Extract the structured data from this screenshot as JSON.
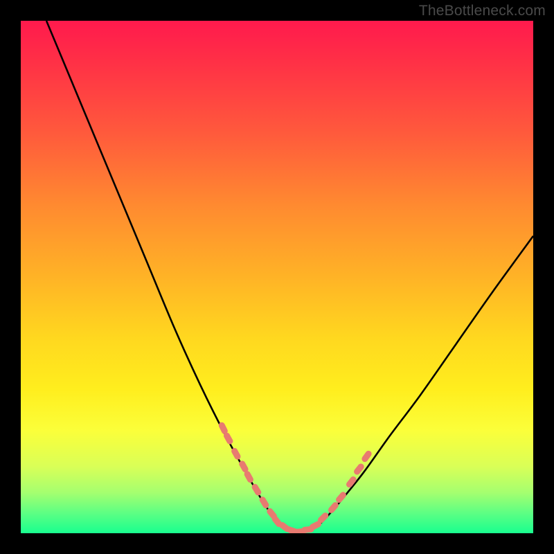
{
  "watermark": "TheBottleneck.com",
  "colors": {
    "background": "#000000",
    "curve_stroke": "#000000",
    "marker_fill": "#e87a70",
    "gradient_top": "#ff1a4d",
    "gradient_bottom": "#19ff8f"
  },
  "chart_data": {
    "type": "line",
    "title": "",
    "xlabel": "",
    "ylabel": "",
    "xlim": [
      0,
      100
    ],
    "ylim": [
      0,
      100
    ],
    "note": "V-shaped bottleneck curve on vertical gradient; y decreases downward visually, minimum near x≈54 at y≈0. Values are percentages read against the plot area.",
    "series": [
      {
        "name": "bottleneck-curve",
        "x": [
          5,
          10,
          15,
          20,
          25,
          30,
          35,
          40,
          45,
          48,
          50,
          52,
          54,
          56,
          58,
          60,
          63,
          67,
          72,
          78,
          85,
          92,
          100
        ],
        "values": [
          100,
          88,
          76,
          64,
          52,
          40,
          29,
          19,
          10,
          5,
          2.5,
          1,
          0.3,
          0.5,
          1.5,
          3.5,
          7,
          12,
          19,
          27,
          37,
          47,
          58
        ]
      }
    ],
    "markers": {
      "name": "highlighted-points",
      "note": "Salmon pill-shaped markers along the lower portion of the V",
      "x": [
        39.5,
        40.5,
        42,
        43.5,
        44.5,
        46,
        47.5,
        49,
        50,
        51.5,
        53,
        54.5,
        56,
        57.5,
        59,
        61,
        62.5,
        64.5,
        66,
        67.5
      ],
      "values": [
        20.5,
        18.5,
        15.5,
        13,
        11,
        8.5,
        6,
        3.8,
        2.3,
        1.2,
        0.5,
        0.3,
        0.7,
        1.5,
        3,
        5,
        7,
        10,
        12.5,
        15
      ]
    }
  }
}
